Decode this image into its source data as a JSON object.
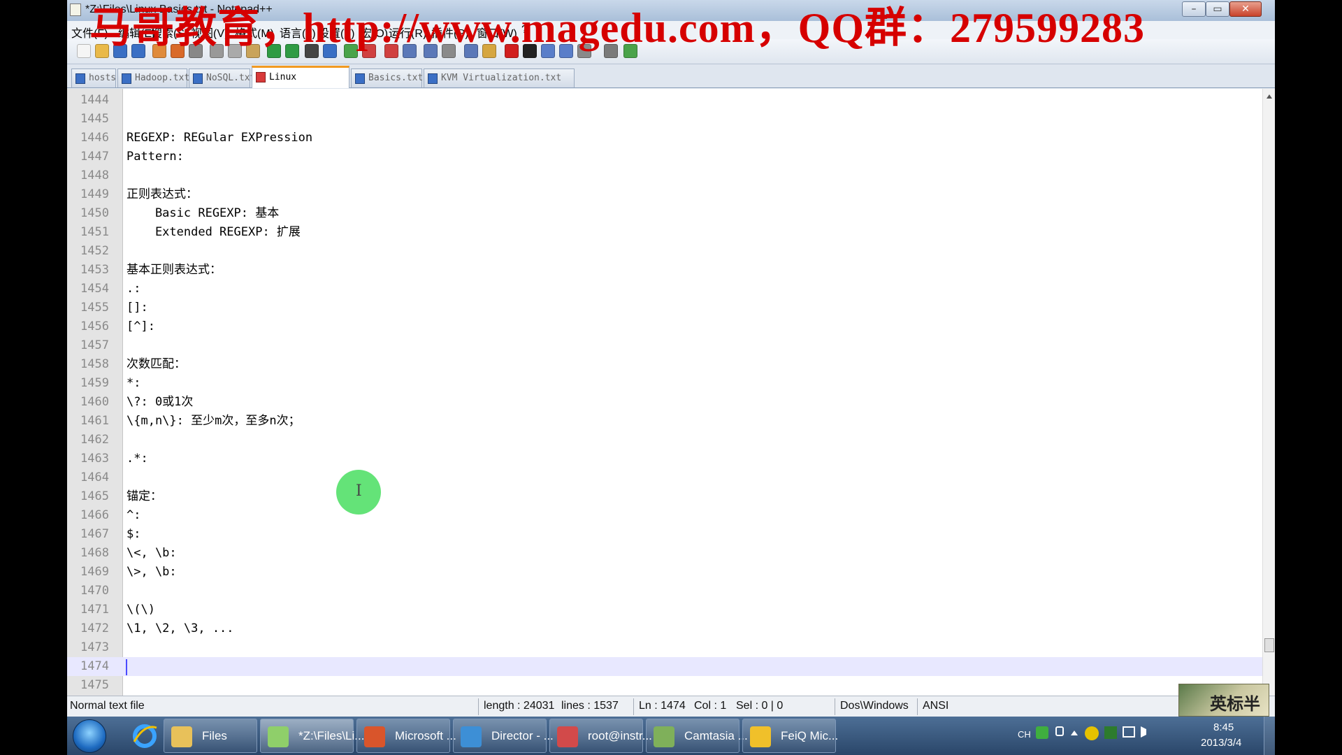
{
  "window": {
    "title": "*Z:\\Files\\Linux Basics.txt - Notepad++",
    "min_glyph": "–",
    "max_glyph": "▭",
    "close_glyph": "✕"
  },
  "watermark": "马哥教育，http://www.magedu.com，QQ群：279599283",
  "menu": [
    "文件(F)",
    "编辑(E)",
    "搜索(S)",
    "视图(V)",
    "格式(M)",
    "语言(L)",
    "设置(T)",
    "宏(O)",
    "运行(R)",
    "插件(P)",
    "窗口(W)",
    "?"
  ],
  "tabs": [
    {
      "label": "hosts",
      "active": false
    },
    {
      "label": "Hadoop.txt",
      "active": false
    },
    {
      "label": "NoSQL.txt",
      "active": false
    },
    {
      "label": "Linux Basics.txt",
      "active": true
    },
    {
      "label": "Basics.txt",
      "active": false
    },
    {
      "label": "KVM Virtualization.txt",
      "active": false
    }
  ],
  "editor": {
    "lines": [
      {
        "n": "1444",
        "text": ""
      },
      {
        "n": "1445",
        "text": ""
      },
      {
        "n": "1446",
        "text": "REGEXP: REGular EXPression"
      },
      {
        "n": "1447",
        "text": "Pattern:"
      },
      {
        "n": "1448",
        "text": ""
      },
      {
        "n": "1449",
        "text": "正则表达式："
      },
      {
        "n": "1450",
        "text": "    Basic REGEXP: 基本"
      },
      {
        "n": "1451",
        "text": "    Extended REGEXP: 扩展"
      },
      {
        "n": "1452",
        "text": ""
      },
      {
        "n": "1453",
        "text": "基本正则表达式："
      },
      {
        "n": "1454",
        "text": ".:"
      },
      {
        "n": "1455",
        "text": "[]:"
      },
      {
        "n": "1456",
        "text": "[^]:"
      },
      {
        "n": "1457",
        "text": ""
      },
      {
        "n": "1458",
        "text": "次数匹配："
      },
      {
        "n": "1459",
        "text": "*:"
      },
      {
        "n": "1460",
        "text": "\\?: 0或1次"
      },
      {
        "n": "1461",
        "text": "\\{m,n\\}: 至少m次，至多n次；"
      },
      {
        "n": "1462",
        "text": ""
      },
      {
        "n": "1463",
        "text": ".*:"
      },
      {
        "n": "1464",
        "text": ""
      },
      {
        "n": "1465",
        "text": "锚定："
      },
      {
        "n": "1466",
        "text": "^:"
      },
      {
        "n": "1467",
        "text": "$:"
      },
      {
        "n": "1468",
        "text": "\\<, \\b:"
      },
      {
        "n": "1469",
        "text": "\\>, \\b:"
      },
      {
        "n": "1470",
        "text": ""
      },
      {
        "n": "1471",
        "text": "\\(\\)"
      },
      {
        "n": "1472",
        "text": "\\1, \\2, \\3, ..."
      },
      {
        "n": "1473",
        "text": ""
      },
      {
        "n": "1474",
        "text": "",
        "current": true
      },
      {
        "n": "1475",
        "text": ""
      }
    ],
    "cursor_glyph": "I"
  },
  "status": {
    "file_type": "Normal text file",
    "length": "length : 24031",
    "lines": "lines : 1537",
    "ln": "Ln : 1474",
    "col": "Col : 1",
    "sel": "Sel : 0 | 0",
    "eol": "Dos\\Windows",
    "encoding": "ANSI",
    "stamp": "英标半"
  },
  "taskbar": {
    "tasks": [
      {
        "label": "Files",
        "color": "#e8c15a",
        "active": false
      },
      {
        "label": "*Z:\\Files\\Li...",
        "color": "#8fcf6a",
        "active": true
      },
      {
        "label": "Microsoft ...",
        "color": "#d9552b",
        "active": false
      },
      {
        "label": "Director - ...",
        "color": "#3d8fd6",
        "active": false
      },
      {
        "label": "root@instr...",
        "color": "#d24a4a",
        "active": false
      },
      {
        "label": "Camtasia ...",
        "color": "#7fb05a",
        "active": false
      },
      {
        "label": "FeiQ Mic...",
        "color": "#f0c02a",
        "active": false
      }
    ],
    "tray": {
      "lang": "CH",
      "time": "8:45",
      "date": "2013/3/4"
    }
  },
  "colors": {
    "accent_tab": "#f29a22",
    "current_line": "#e8e8ff",
    "watermark": "#d60000"
  }
}
